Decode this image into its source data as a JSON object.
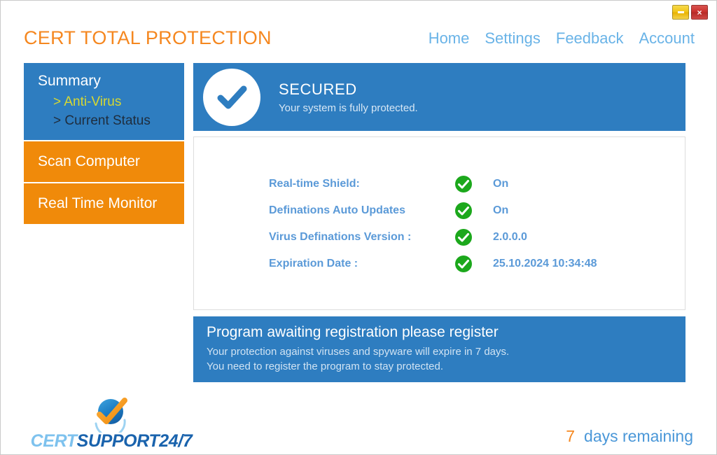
{
  "window": {
    "controls": [
      {
        "name": "minimize",
        "glyph": ""
      },
      {
        "name": "close",
        "glyph": "×"
      }
    ]
  },
  "header": {
    "title": "CERT TOTAL PROTECTION",
    "nav": [
      {
        "label": "Home"
      },
      {
        "label": "Settings"
      },
      {
        "label": "Feedback"
      },
      {
        "label": "Account"
      }
    ]
  },
  "sidebar": {
    "summary": {
      "title": "Summary",
      "items": [
        {
          "label": "> Anti-Virus"
        },
        {
          "label": "> Current Status"
        }
      ]
    },
    "buttons": [
      {
        "label": "Scan Computer"
      },
      {
        "label": "Real Time Monitor"
      }
    ]
  },
  "main": {
    "secured": {
      "title": "SECURED",
      "subtitle": "Your system is fully protected."
    },
    "status_rows": [
      {
        "label": "Real-time Shield:",
        "value": "On"
      },
      {
        "label": "Definations Auto Updates",
        "value": "On"
      },
      {
        "label": "Virus Definations Version :",
        "value": "2.0.0.0"
      },
      {
        "label": "Expiration Date :",
        "value": "25.10.2024 10:34:48"
      }
    ],
    "registration": {
      "title": "Program awaiting registration please register",
      "line1": "Your protection against viruses and spyware will expire in 7 days.",
      "line2": "You need to register the program to stay protected."
    }
  },
  "footer": {
    "logo": {
      "part1": "CERT",
      "part2": "SUPPORT24/7"
    },
    "days_number": "7",
    "days_label": "days remaining"
  },
  "colors": {
    "brand_orange": "#f5871f",
    "panel_blue": "#2e7dc0",
    "button_orange": "#f08a0a",
    "text_blue": "#5b9ad8",
    "link_blue": "#69b3e7",
    "status_green": "#1ca81c",
    "accent_yellow": "#d7d832"
  }
}
